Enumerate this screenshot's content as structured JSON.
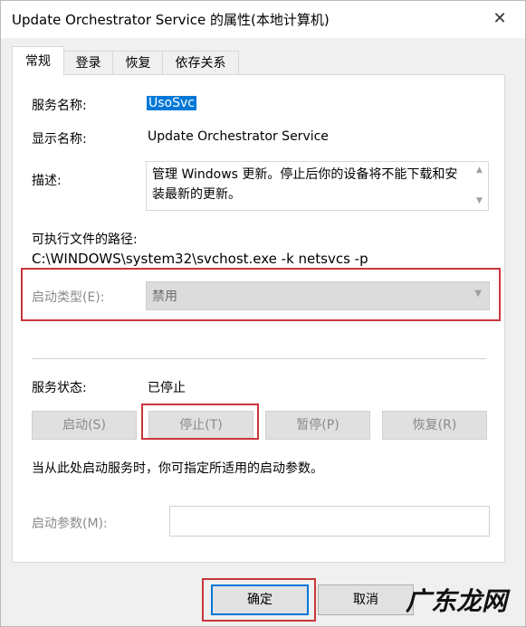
{
  "window": {
    "title": "Update Orchestrator Service 的属性(本地计算机)",
    "close_glyph": "✕"
  },
  "tabs": [
    {
      "label": "常规"
    },
    {
      "label": "登录"
    },
    {
      "label": "恢复"
    },
    {
      "label": "依存关系"
    }
  ],
  "general": {
    "service_name_label": "服务名称:",
    "service_name_value": "UsoSvc",
    "display_name_label": "显示名称:",
    "display_name_value": "Update Orchestrator Service",
    "description_label": "描述:",
    "description_value": "管理 Windows 更新。停止后你的设备将不能下载和安装最新的更新。",
    "exec_path_label": "可执行文件的路径:",
    "exec_path_value": "C:\\WINDOWS\\system32\\svchost.exe -k netsvcs -p",
    "startup_type_label": "启动类型(E):",
    "startup_type_value": "禁用",
    "service_status_label": "服务状态:",
    "service_status_value": "已停止",
    "buttons": {
      "start": "启动(S)",
      "stop": "停止(T)",
      "pause": "暂停(P)",
      "resume": "恢复(R)"
    },
    "hint_text": "当从此处启动服务时，你可指定所适用的启动参数。",
    "start_params_label": "启动参数(M):",
    "start_params_value": ""
  },
  "footer": {
    "ok": "确定",
    "cancel": "取消",
    "watermark": "广东龙网"
  },
  "colors": {
    "highlight": "#0078d7",
    "annotation_red": "#c9363b"
  }
}
